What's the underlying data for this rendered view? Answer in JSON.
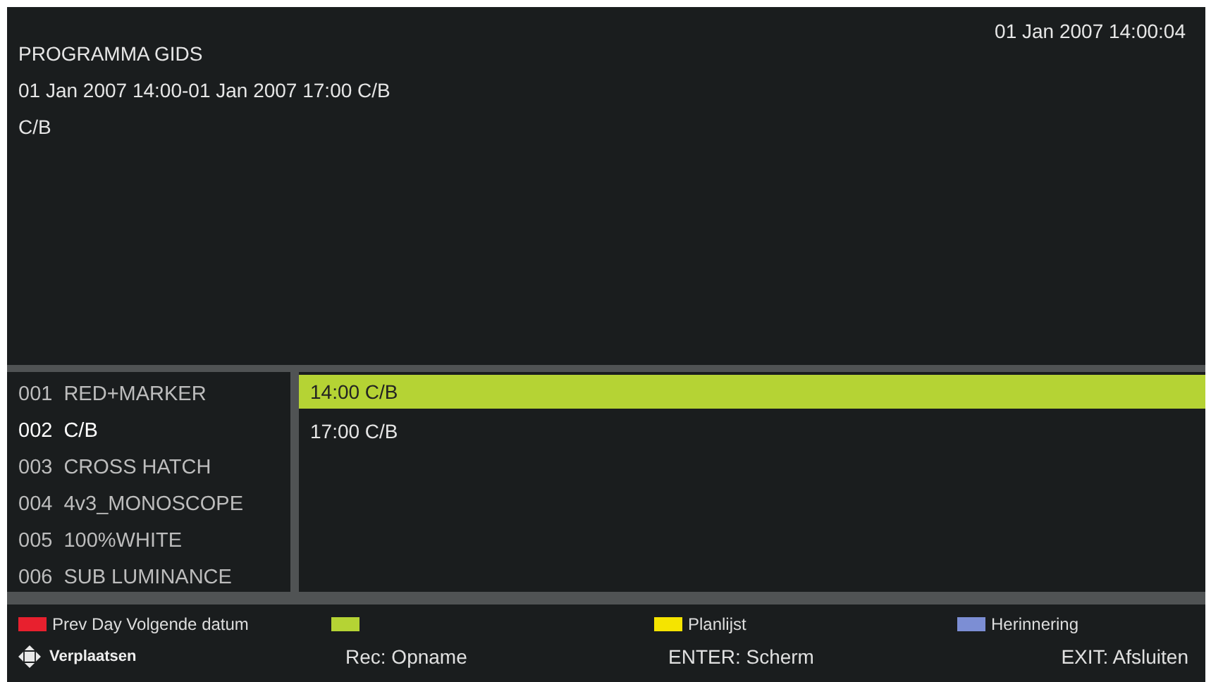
{
  "header": {
    "title": "PROGRAMMA GIDS",
    "clock": "01 Jan 2007 14:00:04",
    "time_range": "01 Jan 2007 14:00-01 Jan 2007 17:00 C/B",
    "description": "C/B"
  },
  "channels": [
    {
      "number": "001",
      "name": "RED+MARKER",
      "selected": false
    },
    {
      "number": "002",
      "name": "C/B",
      "selected": true
    },
    {
      "number": "003",
      "name": "CROSS HATCH",
      "selected": false
    },
    {
      "number": "004",
      "name": "4v3_MONOSCOPE",
      "selected": false
    },
    {
      "number": "005",
      "name": "100%WHITE",
      "selected": false
    },
    {
      "number": "006",
      "name": "SUB LUMINANCE",
      "selected": false
    }
  ],
  "programmes": [
    {
      "label": "14:00 C/B",
      "selected": true
    },
    {
      "label": "17:00 C/B",
      "selected": false
    }
  ],
  "color_keys": [
    {
      "color": "#e8202e",
      "label": "Prev Day Volgende datum"
    },
    {
      "color": "#b5d334"
    },
    {
      "color": "#f5e400",
      "label": "Planlijst"
    },
    {
      "color": "#7c8ed4",
      "label": "Herinnering"
    }
  ],
  "key_hints": [
    {
      "kind": "navigate",
      "label": "Verplaatsen"
    },
    {
      "kind": "text",
      "label": "Rec: Opname"
    },
    {
      "kind": "text",
      "label": "ENTER: Scherm"
    },
    {
      "kind": "text",
      "label": "EXIT: Afsluiten"
    }
  ]
}
